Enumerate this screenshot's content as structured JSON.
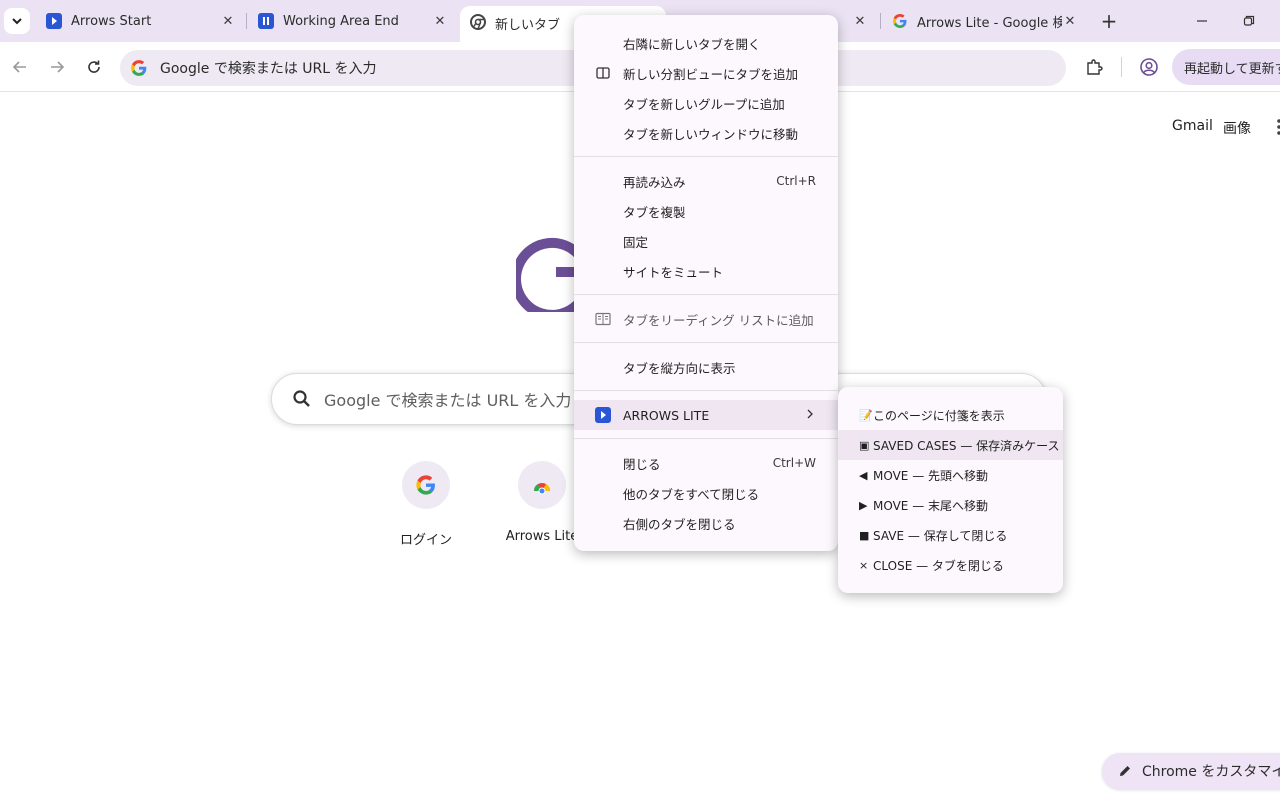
{
  "tabs": [
    {
      "title": "Arrows Start",
      "icon": "arrows-play-icon"
    },
    {
      "title": "Working Area End",
      "icon": "pause-icon"
    },
    {
      "title": "新しいタブ",
      "icon": "chrome-icon"
    },
    {
      "title": "Arrows Lite - Google 検索",
      "icon": "google-icon"
    }
  ],
  "toolbar": {
    "omnibox_text": "Google で検索または URL を入力",
    "restart_label": "再起動して更新する"
  },
  "page": {
    "gmail": "Gmail",
    "images": "画像",
    "search_placeholder": "Google で検索または URL を入力",
    "shortcuts": [
      {
        "label": "ログイン"
      },
      {
        "label": "Arrows Lite"
      }
    ],
    "customize_label": "Chrome をカスタマイズ"
  },
  "context_menu": {
    "items": [
      {
        "label": "右隣に新しいタブを開く",
        "shortcut": ""
      },
      {
        "label": "新しい分割ビューにタブを追加",
        "shortcut": ""
      },
      {
        "label": "タブを新しいグループに追加",
        "shortcut": ""
      },
      {
        "label": "タブを新しいウィンドウに移動",
        "shortcut": ""
      },
      {
        "label": "再読み込み",
        "shortcut": "Ctrl+R"
      },
      {
        "label": "タブを複製",
        "shortcut": ""
      },
      {
        "label": "固定",
        "shortcut": ""
      },
      {
        "label": "サイトをミュート",
        "shortcut": ""
      },
      {
        "label": "タブをリーディング リストに追加",
        "shortcut": ""
      },
      {
        "label": "タブを縦方向に表示",
        "shortcut": ""
      },
      {
        "label": "ARROWS LITE",
        "shortcut": ""
      },
      {
        "label": "閉じる",
        "shortcut": "Ctrl+W"
      },
      {
        "label": "他のタブをすべて閉じる",
        "shortcut": ""
      },
      {
        "label": "右側のタブを閉じる",
        "shortcut": ""
      }
    ]
  },
  "submenu": {
    "items": [
      {
        "label": "このページに付箋を表示"
      },
      {
        "label": "SAVED CASES — 保存済みケース"
      },
      {
        "label": "MOVE — 先頭へ移動"
      },
      {
        "label": "MOVE — 末尾へ移動"
      },
      {
        "label": "SAVE — 保存して閉じる"
      },
      {
        "label": "CLOSE — タブを閉じる"
      }
    ]
  },
  "colors": {
    "tabstrip_bg": "#ebe3f3",
    "accent_purple": "#6b4f96",
    "arrows_blue": "#2a56d6",
    "menu_bg": "#fdf8fd",
    "highlight": "#efe6f2"
  }
}
